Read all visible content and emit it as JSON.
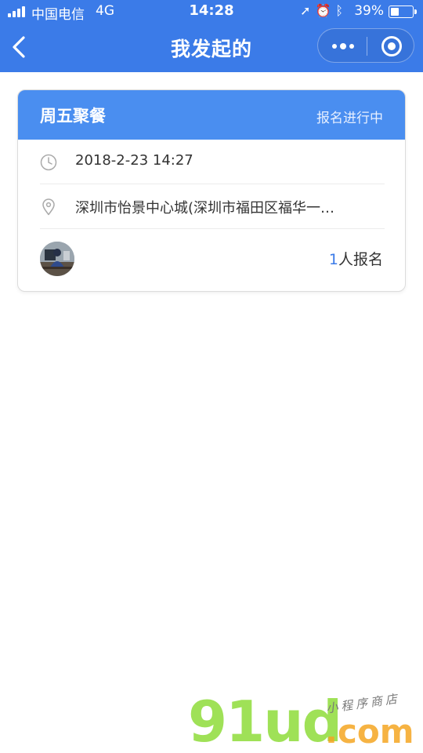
{
  "status_bar": {
    "carrier": "中国电信",
    "network": "4G",
    "time": "14:28",
    "battery_percent": "39%",
    "battery_level": 0.39,
    "icons": [
      "location-arrow-icon",
      "alarm-icon",
      "bluetooth-icon"
    ]
  },
  "nav": {
    "title": "我发起的",
    "back_icon": "chevron-left-icon",
    "more_icon": "more-dots-icon",
    "close_icon": "target-close-icon"
  },
  "event": {
    "title": "周五聚餐",
    "status": "报名进行中",
    "time": "2018-2-23 14:27",
    "location": "深圳市怡景中心城(深圳市福田区福华一…",
    "signup_count": "1",
    "signup_label": "人报名"
  },
  "watermark": {
    "logo": "91ud",
    "domain": ".com",
    "tagline": "小程序商店"
  },
  "colors": {
    "accent": "#3b7be8",
    "card_header": "#4a8ef0",
    "background": "#ffffff"
  }
}
